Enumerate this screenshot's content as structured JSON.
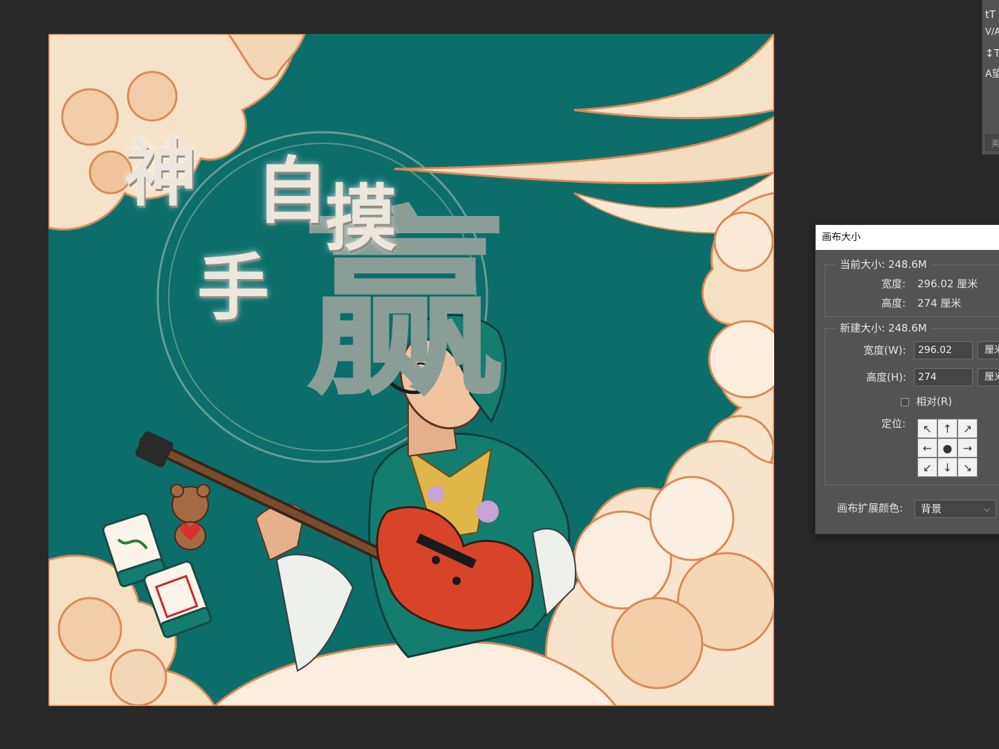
{
  "artwork": {
    "title_chars": [
      "神",
      "手",
      "自",
      "摸"
    ],
    "big_char": "赢"
  },
  "char_panel": {
    "rows": [
      "tT",
      "V/A",
      "↕T",
      "A望"
    ],
    "button_label": "美"
  },
  "dialog": {
    "title": "画布大小",
    "current_size": {
      "legend": "当前大小: 248.6M",
      "width_label": "宽度:",
      "width_value": "296.02 厘米",
      "height_label": "高度:",
      "height_value": "274 厘米"
    },
    "new_size": {
      "legend": "新建大小: 248.6M",
      "width_label": "宽度(W):",
      "width_hotkey": "W",
      "width_value": "296.02",
      "width_unit": "厘米",
      "height_label": "高度(H):",
      "height_hotkey": "H",
      "height_value": "274",
      "height_unit": "厘米",
      "relative_label": "相对(R)",
      "relative_hotkey": "R",
      "relative_checked": false,
      "anchor_label": "定位:",
      "anchor_cells": [
        "↖",
        "↑",
        "↗",
        "←",
        "●",
        "→",
        "↙",
        "↓",
        "↘"
      ]
    },
    "extension_color_label": "画布扩展颜色:",
    "extension_color_value": "背景"
  },
  "colors": {
    "canvas_teal": "#0b6e6a",
    "cloud_cream": "#f6e2c8",
    "cloud_outline": "#d98a55",
    "guitar_red": "#d8442a",
    "robe_teal": "#137d70"
  }
}
